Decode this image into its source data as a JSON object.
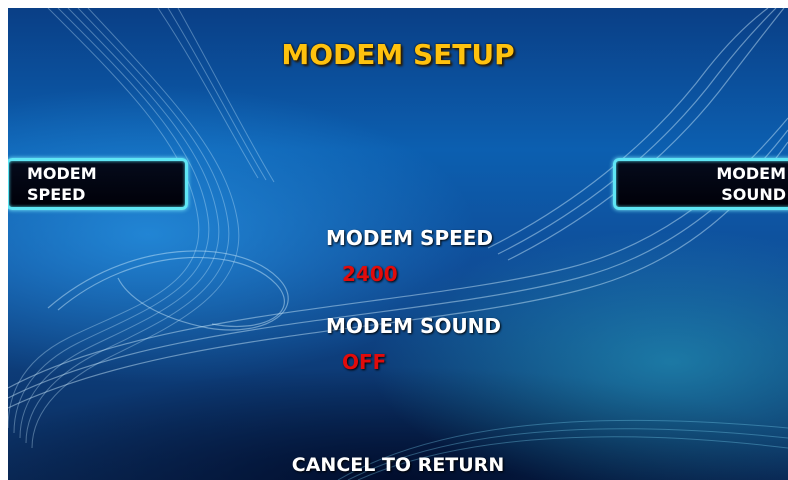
{
  "screen": {
    "title": "MODEM SETUP",
    "footer": "CANCEL TO RETURN"
  },
  "softkeys": {
    "left": {
      "line1": "MODEM",
      "line2": "SPEED"
    },
    "right": {
      "line1": "MODEM",
      "line2": "SOUND"
    }
  },
  "settings": {
    "speed": {
      "label": "MODEM SPEED",
      "value": "2400"
    },
    "sound": {
      "label": "MODEM SOUND",
      "value": "OFF"
    }
  },
  "colors": {
    "title": "#ffc20e",
    "value": "#e10b0b",
    "softkey_border": "#5fe6f5",
    "background": "#0c5fb0"
  }
}
